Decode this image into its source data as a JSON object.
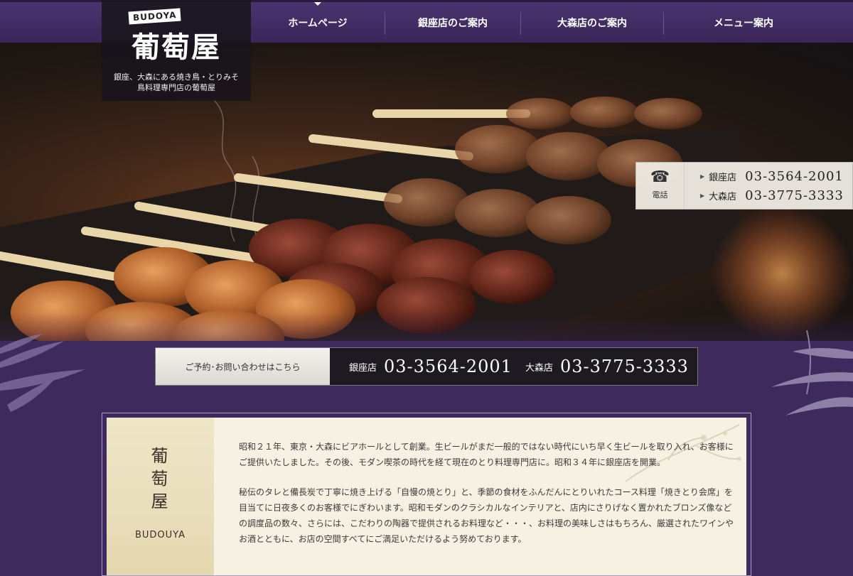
{
  "logo": {
    "en": "BUDOYA",
    "jp": "葡萄屋",
    "tagline_1": "銀座、大森にある焼き鳥・とりみそ",
    "tagline_2": "鳥料理専門店の葡萄屋"
  },
  "nav": {
    "items": [
      {
        "label": "ホームページ",
        "active": true
      },
      {
        "label": "銀座店のご案内"
      },
      {
        "label": "大森店のご案内"
      },
      {
        "label": "メニュー案内"
      }
    ]
  },
  "phonebox": {
    "icon": "phone-icon",
    "label": "電話",
    "rows": [
      {
        "store": "銀座店",
        "number": "03-3564-2001"
      },
      {
        "store": "大森店",
        "number": "03-3775-3333"
      }
    ]
  },
  "contact": {
    "label": "ご予約･お問い合わせはこちら",
    "stores": [
      {
        "store": "銀座店",
        "number": "03-3564-2001"
      },
      {
        "store": "大森店",
        "number": "03-3775-3333"
      }
    ]
  },
  "about": {
    "title_jp": "葡萄屋",
    "title_en": "BUDOUYA",
    "paragraph_1": "昭和２１年、東京・大森にビアホールとして創業。生ビールがまだ一般的ではない時代にいち早く生ビールを取り入れ、お客様にご提供いたしました。その後、モダン喫茶の時代を経て現在のとり料理専門店に。昭和３４年に銀座店を開業。",
    "paragraph_2": "秘伝のタレと備長炭で丁寧に焼き上げる「自慢の焼とり」と、季節の食材をふんだんにとりいれたコース料理「焼きとり会席」を目当てに日夜多くのお客様でにぎわいます。昭和モダンのクラシカルなインテリアと、店内にさりげなく置かれたブロンズ像などの調度品の数々、さらには、こだわりの陶器で提供されるお料理など・・・、お料理の美味しさはもちろん、厳選されたワインやお酒とともに、お店の空間すべてにご満足いただけるよう努めております。"
  },
  "colors": {
    "brand_purple": "#3e2a5c",
    "panel_cream": "#f6f1e2"
  }
}
